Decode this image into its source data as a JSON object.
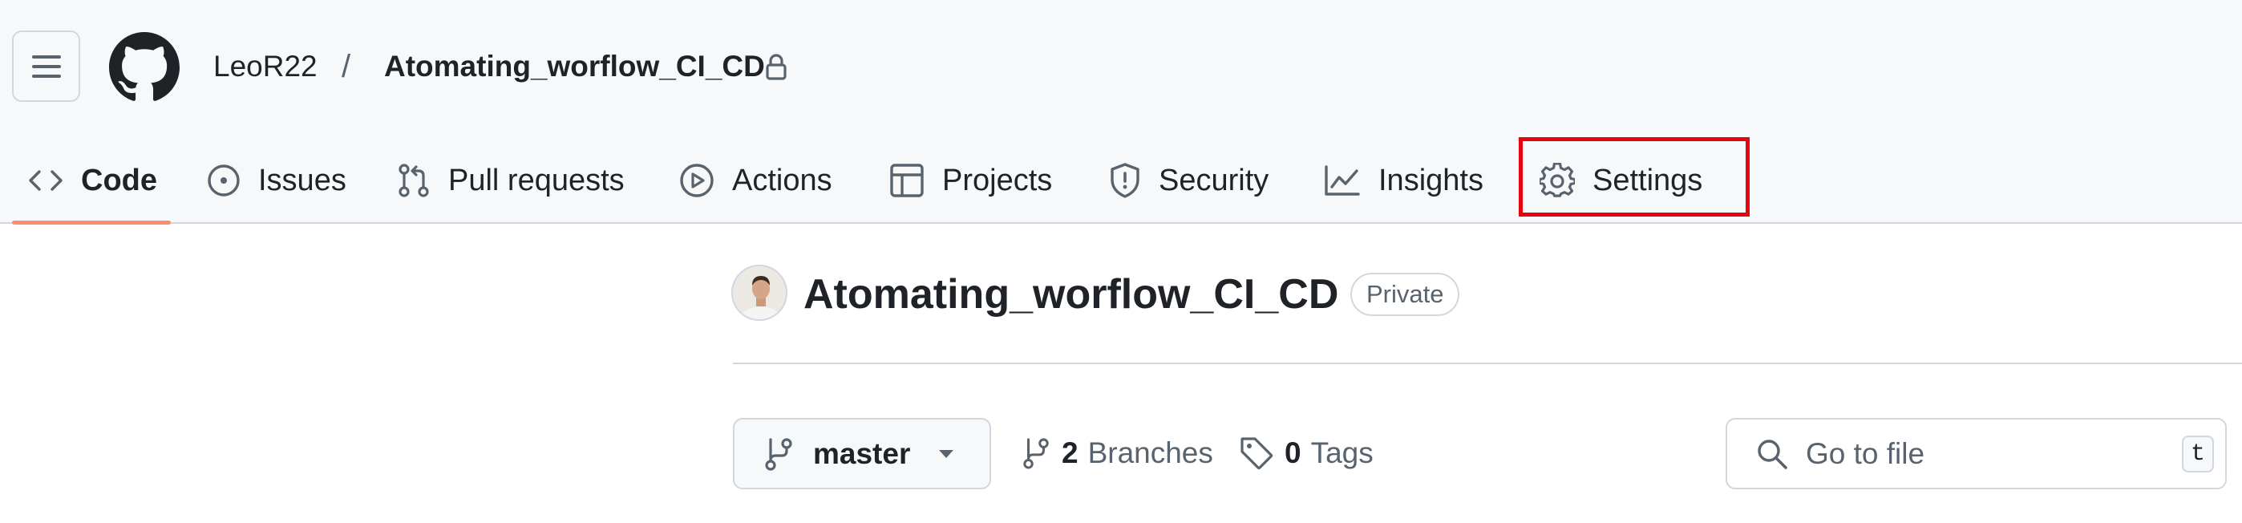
{
  "breadcrumb": {
    "owner": "LeoR22",
    "separator": "/",
    "repo": "Atomating_worflow_CI_CD"
  },
  "tabs": [
    {
      "label": "Code",
      "icon": "code-icon",
      "selected": true
    },
    {
      "label": "Issues",
      "icon": "issue-opened-icon"
    },
    {
      "label": "Pull requests",
      "icon": "git-pull-request-icon"
    },
    {
      "label": "Actions",
      "icon": "play-icon"
    },
    {
      "label": "Projects",
      "icon": "table-icon"
    },
    {
      "label": "Security",
      "icon": "shield-icon"
    },
    {
      "label": "Insights",
      "icon": "graph-icon"
    },
    {
      "label": "Settings",
      "icon": "gear-icon",
      "highlighted": true
    }
  ],
  "repo": {
    "title": "Atomating_worflow_CI_CD",
    "visibility": "Private"
  },
  "toolbar": {
    "branch": "master",
    "branches_count": "2",
    "branches_label": "Branches",
    "tags_count": "0",
    "tags_label": "Tags",
    "goto_placeholder": "Go to file",
    "goto_shortcut": "t"
  },
  "colors": {
    "selected_tab_underline": "#fd8c73",
    "highlight_box": "#e3060f",
    "header_bg": "#f6f8fa",
    "border": "#d0d7de"
  }
}
